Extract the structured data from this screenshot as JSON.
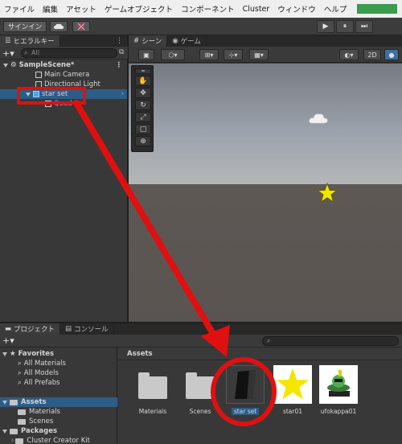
{
  "menu": [
    "ファイル",
    "編集",
    "アセット",
    "ゲームオブジェクト",
    "コンポーネント",
    "Cluster",
    "ウィンドウ",
    "ヘルプ"
  ],
  "toolbar": {
    "signin_label": "サインイン",
    "cloud_icon": "cloud-icon",
    "collab_icon": "collab-icon",
    "play_icon": "▶",
    "pause_icon": "⏸",
    "step_icon": "⏭"
  },
  "hierarchy": {
    "tab_label": "ヒエラルキー",
    "search_placeholder": "All",
    "scene_name": "SampleScene*",
    "items": [
      "Main Camera",
      "Directional Light",
      "star set",
      "Quad"
    ]
  },
  "scene": {
    "tab_scene": "シーン",
    "tab_game": "ゲーム",
    "mode_2d": "2D"
  },
  "project": {
    "tab_project": "プロジェクト",
    "tab_console": "コンソール",
    "favorites_label": "Favorites",
    "favorites": [
      "All Materials",
      "All Models",
      "All Prefabs"
    ],
    "assets_label": "Assets",
    "asset_folders": [
      "Materials",
      "Scenes"
    ],
    "packages_label": "Packages",
    "packages": [
      "Cluster Creator Kit"
    ],
    "breadcrumb": "Assets",
    "grid_items": [
      "Materials",
      "Scenes",
      "star set",
      "star01",
      "ufokappa01"
    ]
  },
  "colors": {
    "annotation_red": "#e01010",
    "selection_blue": "#2c5d87",
    "star_yellow": "#f5e600"
  }
}
